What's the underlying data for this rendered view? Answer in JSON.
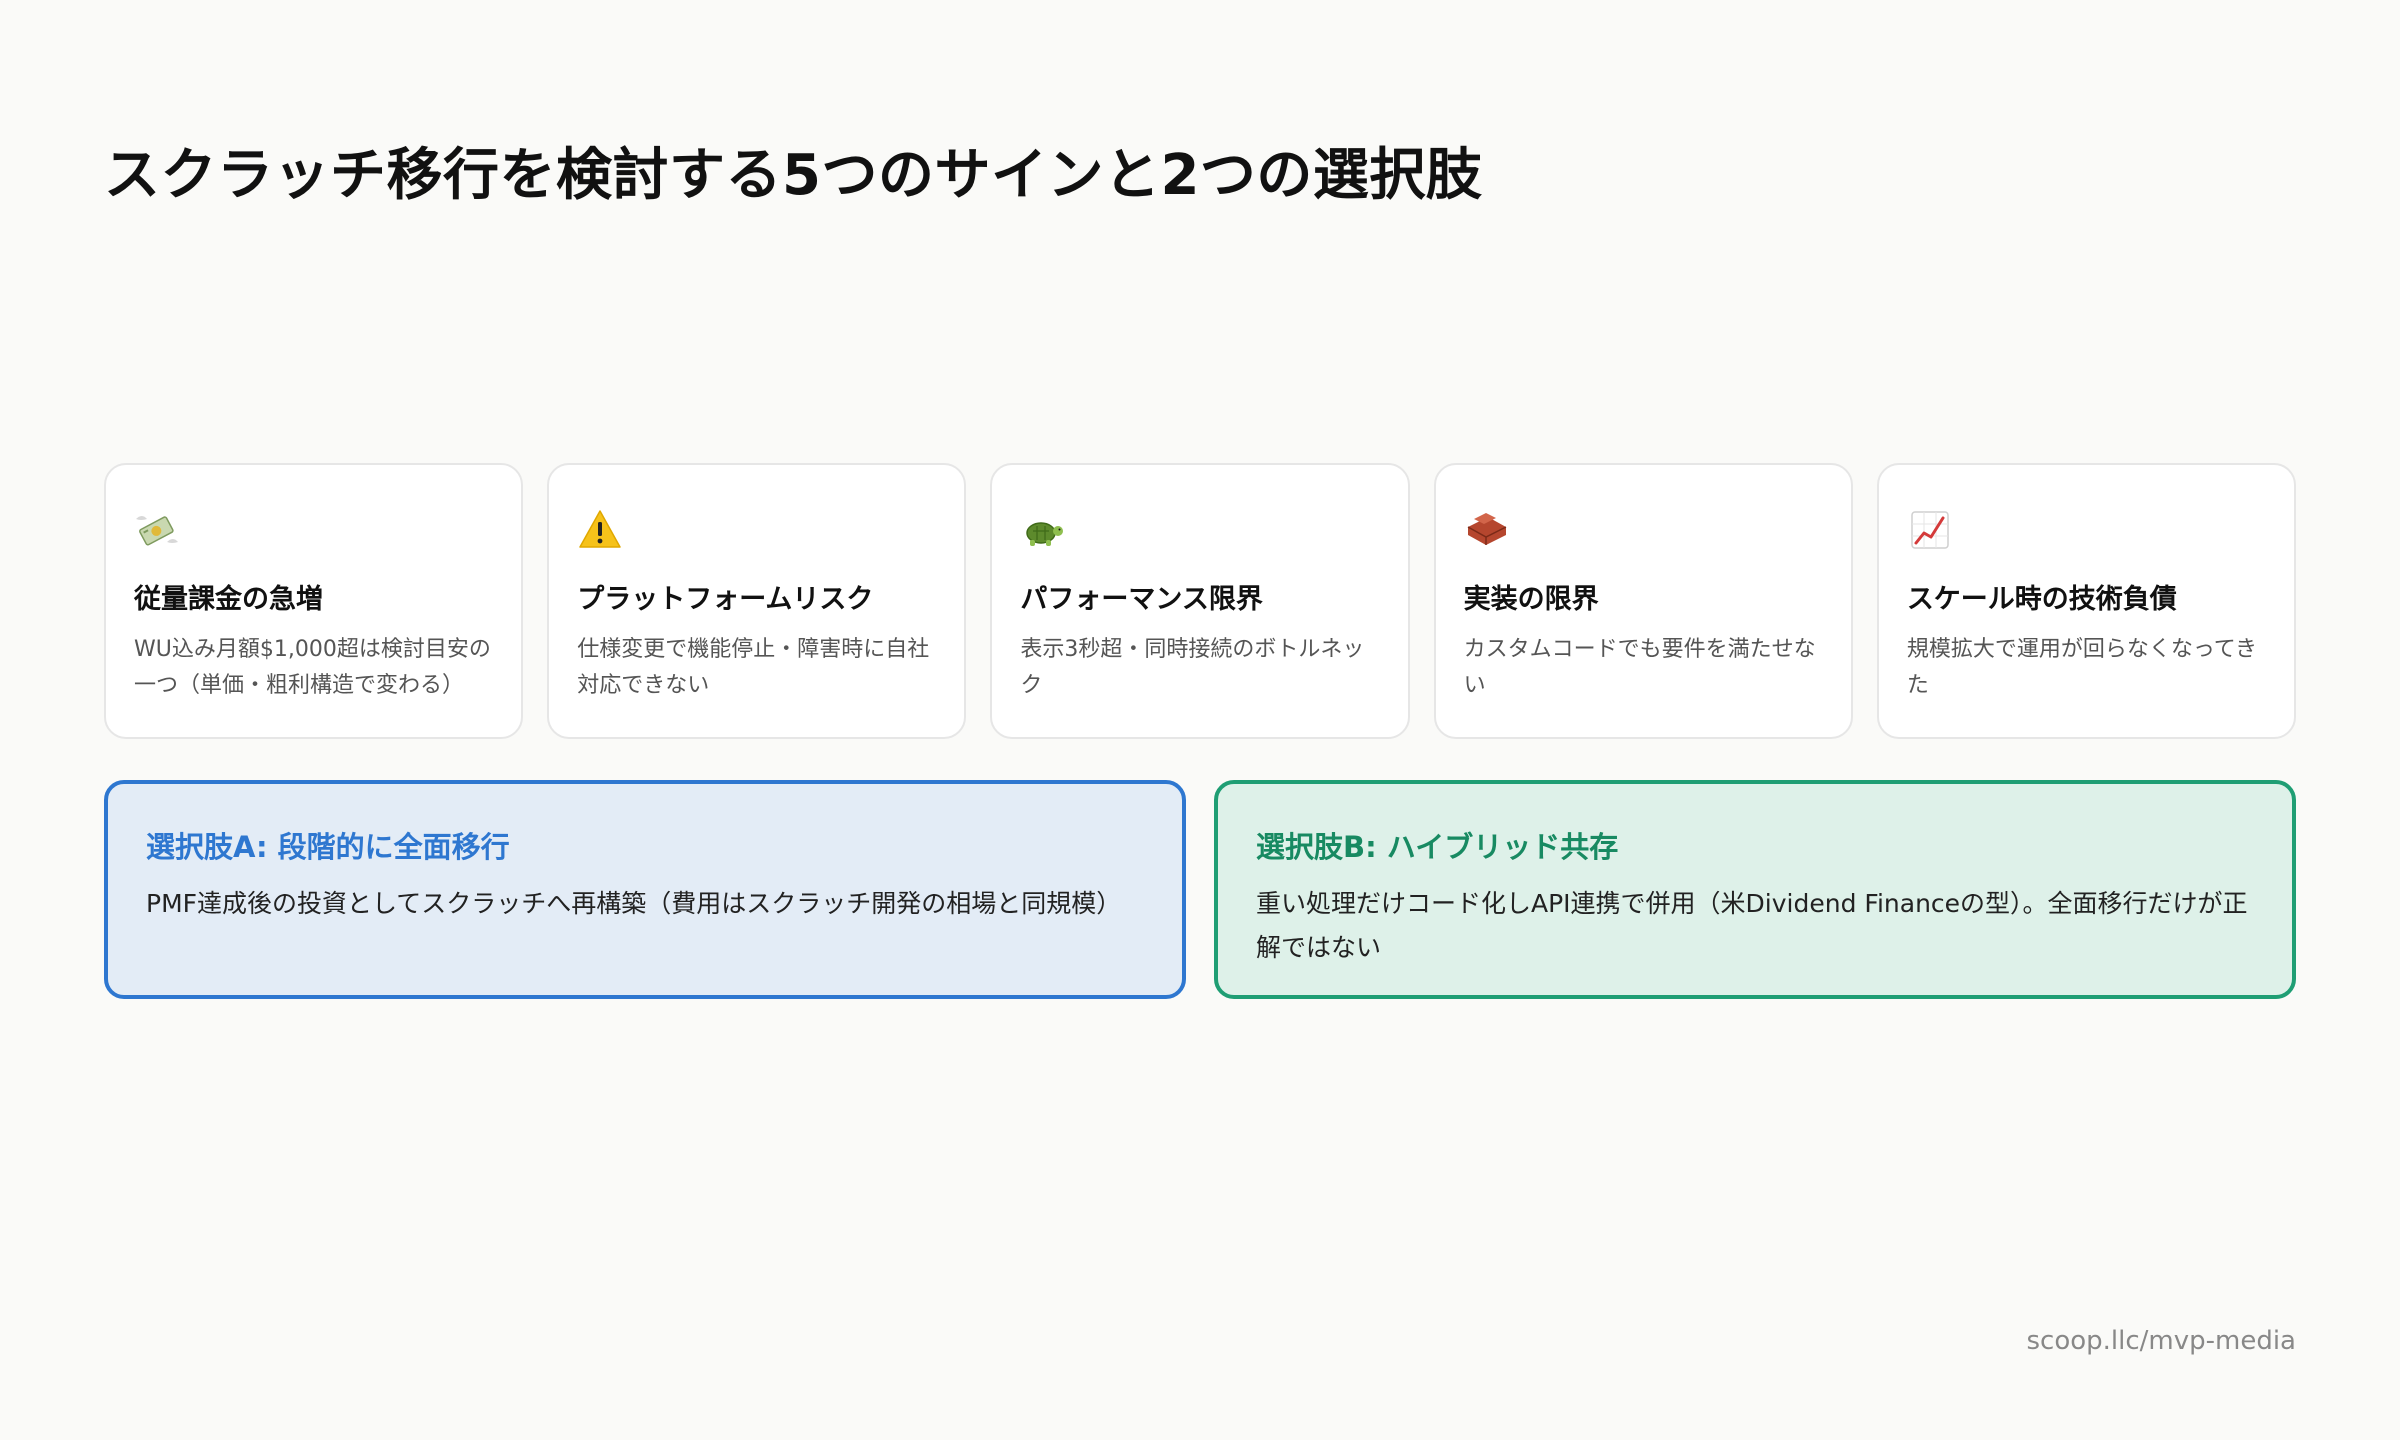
{
  "title": "スクラッチ移行を検討する5つのサインと2つの選択肢",
  "signs": [
    {
      "icon": "money-with-wings-icon",
      "title": "従量課金の急増",
      "description": "WU込み月額$1,000超は検討目安の一つ（単価・粗利構造で変わる）"
    },
    {
      "icon": "warning-icon",
      "title": "プラットフォームリスク",
      "description": "仕様変更で機能停止・障害時に自社対応できない"
    },
    {
      "icon": "turtle-icon",
      "title": "パフォーマンス限界",
      "description": "表示3秒超・同時接続のボトルネック"
    },
    {
      "icon": "bricks-icon",
      "title": "実装の限界",
      "description": "カスタムコードでも要件を満たせない"
    },
    {
      "icon": "chart-increasing-icon",
      "title": "スケール時の技術負債",
      "description": "規模拡大で運用が回らなくなってきた"
    }
  ],
  "options": [
    {
      "title": "選択肢A: 段階的に全面移行",
      "description": "PMF達成後の投資としてスクラッチへ再構築（費用はスクラッチ開発の相場と同規模）",
      "accent": "#2e77d0",
      "background": "#e3ecf6"
    },
    {
      "title": "選択肢B: ハイブリッド共存",
      "description": "重い処理だけコード化しAPI連携で併用（米Dividend Financeの型）。全面移行だけが正解ではない",
      "accent": "#1f9e74",
      "background": "#def1e9"
    }
  ],
  "footer": "scoop.llc/mvp-media"
}
